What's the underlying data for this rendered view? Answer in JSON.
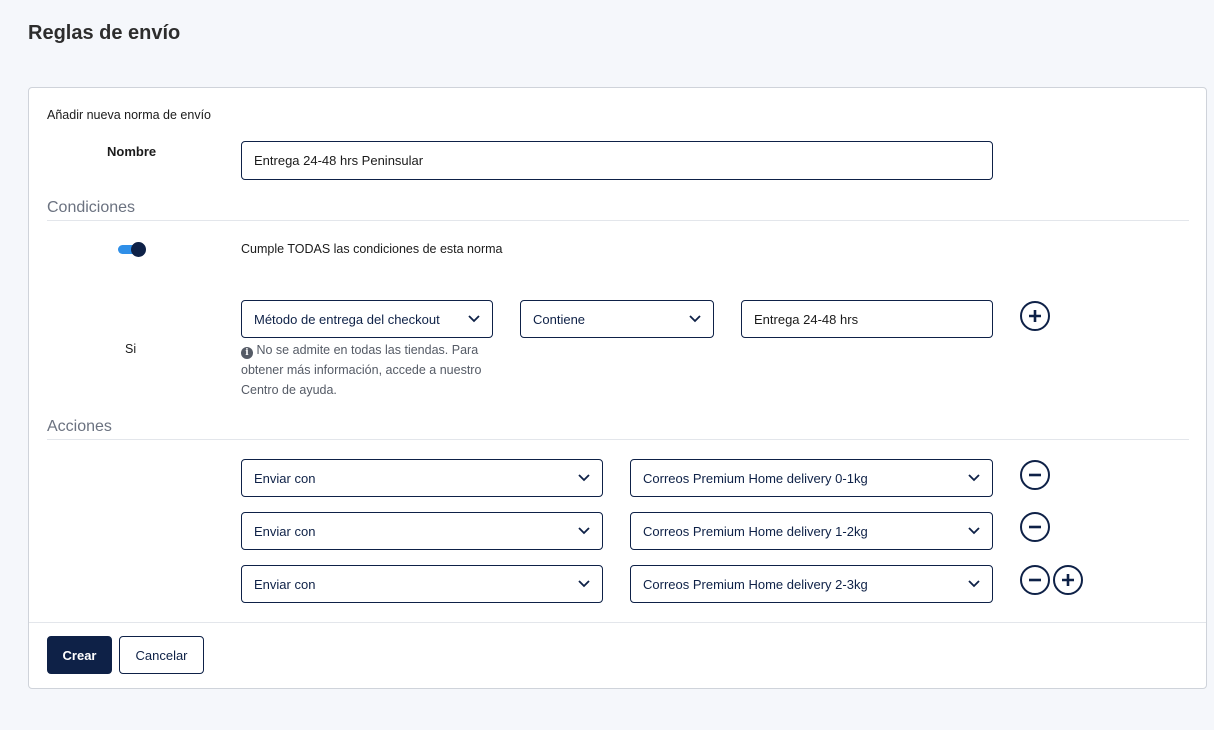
{
  "page": {
    "title": "Reglas de envío"
  },
  "form": {
    "subtitle": "Añadir nueva norma de envío",
    "name_label": "Nombre",
    "name_value": "Entrega 24-48 hrs Peninsular"
  },
  "conditions": {
    "title": "Condiciones",
    "toggle_on": true,
    "toggle_label": "Cumple TODAS las condiciones de esta norma",
    "if_label": "Si",
    "field_select": "Método de entrega del checkout",
    "operator_select": "Contiene",
    "value": "Entrega 24-48 hrs",
    "help_text": "No se admite en todas las tiendas. Para obtener más información, accede a nuestro Centro de ayuda."
  },
  "actions": {
    "title": "Acciones",
    "rows": [
      {
        "action": "Enviar con",
        "service": "Correos Premium Home delivery 0-1kg"
      },
      {
        "action": "Enviar con",
        "service": "Correos Premium Home delivery 1-2kg"
      },
      {
        "action": "Enviar con",
        "service": "Correos Premium Home delivery 2-3kg"
      }
    ]
  },
  "buttons": {
    "create": "Crear",
    "cancel": "Cancelar"
  },
  "colors": {
    "primary": "#0e2147",
    "toggle_track": "#2f8fe8",
    "background": "#f5f7fb"
  },
  "icons": {
    "select_arrow": "chevron-down-icon",
    "add": "plus-circle-icon",
    "remove": "minus-circle-icon",
    "info": "info-icon"
  }
}
